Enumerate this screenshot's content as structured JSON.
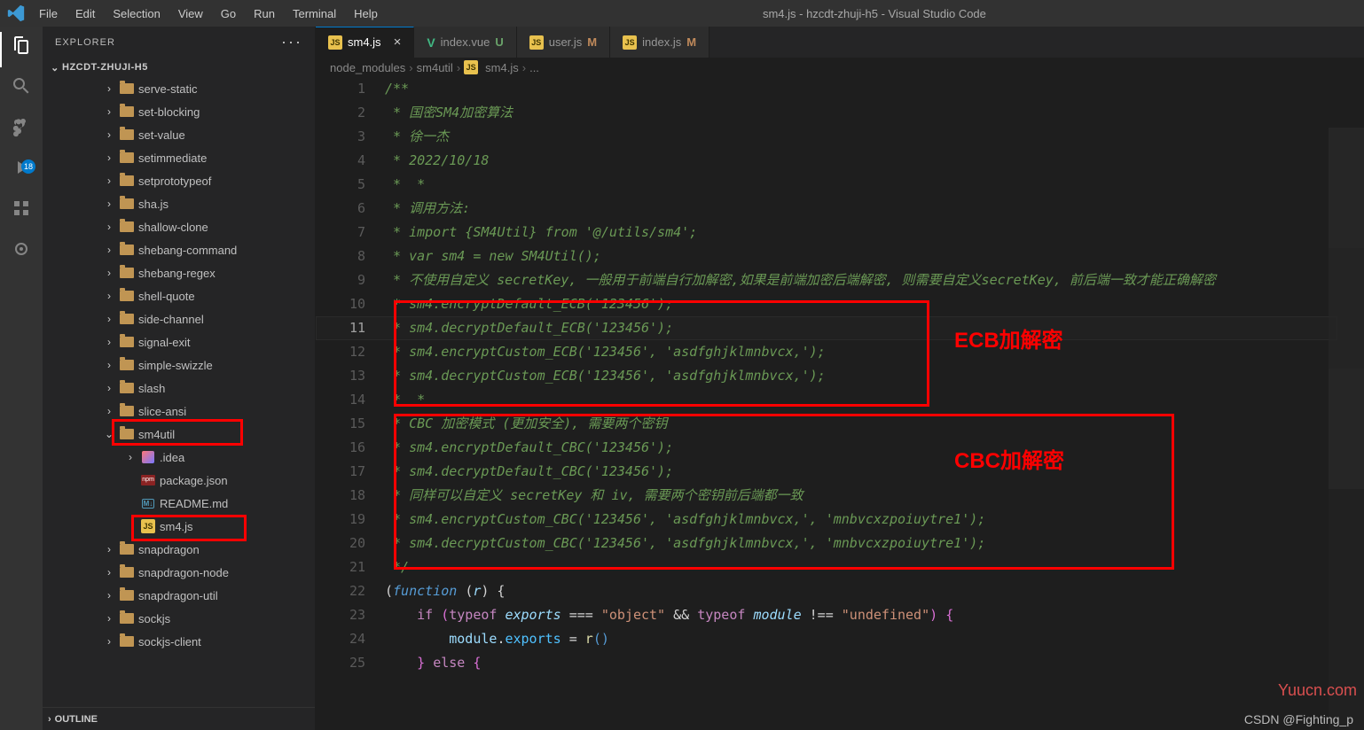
{
  "app": {
    "title": "sm4.js - hzcdt-zhuji-h5 - Visual Studio Code"
  },
  "menu": [
    "File",
    "Edit",
    "Selection",
    "View",
    "Go",
    "Run",
    "Terminal",
    "Help"
  ],
  "activity": {
    "badge": "18"
  },
  "sidebar": {
    "header": "EXPLORER",
    "project": "HZCDT-ZHUJI-H5",
    "tree": [
      {
        "label": "serve-static",
        "kind": "folder",
        "depth": 2
      },
      {
        "label": "set-blocking",
        "kind": "folder",
        "depth": 2
      },
      {
        "label": "set-value",
        "kind": "folder",
        "depth": 2
      },
      {
        "label": "setimmediate",
        "kind": "folder",
        "depth": 2
      },
      {
        "label": "setprototypeof",
        "kind": "folder",
        "depth": 2
      },
      {
        "label": "sha.js",
        "kind": "folder",
        "depth": 2
      },
      {
        "label": "shallow-clone",
        "kind": "folder",
        "depth": 2
      },
      {
        "label": "shebang-command",
        "kind": "folder",
        "depth": 2
      },
      {
        "label": "shebang-regex",
        "kind": "folder",
        "depth": 2
      },
      {
        "label": "shell-quote",
        "kind": "folder",
        "depth": 2
      },
      {
        "label": "side-channel",
        "kind": "folder",
        "depth": 2
      },
      {
        "label": "signal-exit",
        "kind": "folder",
        "depth": 2
      },
      {
        "label": "simple-swizzle",
        "kind": "folder",
        "depth": 2
      },
      {
        "label": "slash",
        "kind": "folder",
        "depth": 2
      },
      {
        "label": "slice-ansi",
        "kind": "folder",
        "depth": 2
      },
      {
        "label": "sm4util",
        "kind": "folder-open",
        "depth": 2
      },
      {
        "label": ".idea",
        "kind": "idea",
        "depth": 3
      },
      {
        "label": "package.json",
        "kind": "pkg",
        "depth": 3,
        "nochev": true
      },
      {
        "label": "README.md",
        "kind": "md",
        "depth": 3,
        "nochev": true
      },
      {
        "label": "sm4.js",
        "kind": "js",
        "depth": 3,
        "nochev": true
      },
      {
        "label": "snapdragon",
        "kind": "folder",
        "depth": 2
      },
      {
        "label": "snapdragon-node",
        "kind": "folder",
        "depth": 2
      },
      {
        "label": "snapdragon-util",
        "kind": "folder",
        "depth": 2
      },
      {
        "label": "sockjs",
        "kind": "folder",
        "depth": 2
      },
      {
        "label": "sockjs-client",
        "kind": "folder",
        "depth": 2
      }
    ],
    "outline": "OUTLINE"
  },
  "tabs": [
    {
      "icon": "js",
      "label": "sm4.js",
      "active": true,
      "close": true
    },
    {
      "icon": "vue",
      "label": "index.vue",
      "flag": "U"
    },
    {
      "icon": "js",
      "label": "user.js",
      "flag": "M"
    },
    {
      "icon": "js",
      "label": "index.js",
      "flag": "M"
    }
  ],
  "breadcrumb": [
    "node_modules",
    "sm4util",
    "sm4.js",
    "..."
  ],
  "breadcrumb_icon_index": 2,
  "code": {
    "start": 1,
    "current": 11,
    "lines": [
      "/**",
      " * 国密SM4加密算法",
      " * 徐一杰",
      " * 2022/10/18",
      " *",
      " * 调用方法:",
      " * import {SM4Util} from '@/utils/sm4';",
      " * var sm4 = new SM4Util();",
      " * 不使用自定义 secretKey, 一般用于前端自行加解密,如果是前端加密后端解密, 则需要自定义secretKey, 前后端一致才能正确解密",
      " * sm4.encryptDefault_ECB('123456');",
      " * sm4.decryptDefault_ECB('123456');",
      " * sm4.encryptCustom_ECB('123456', 'asdfghjklmnbvcx,');",
      " * sm4.decryptCustom_ECB('123456', 'asdfghjklmnbvcx,');",
      " *",
      " * CBC 加密模式 (更加安全), 需要两个密钥",
      " * sm4.encryptDefault_CBC('123456');",
      " * sm4.decryptDefault_CBC('123456');",
      " * 同样可以自定义 secretKey 和 iv, 需要两个密钥前后端都一致",
      " * sm4.encryptCustom_CBC('123456', 'asdfghjklmnbvcx,', 'mnbvcxzpoiuytre1');",
      " * sm4.decryptCustom_CBC('123456', 'asdfghjklmnbvcx,', 'mnbvcxzpoiuytre1');",
      " */"
    ]
  },
  "annotations": {
    "ecb": "ECB加解密",
    "cbc": "CBC加解密"
  },
  "watermark": "Yuucn.com",
  "csdn": "CSDN @Fighting_p"
}
